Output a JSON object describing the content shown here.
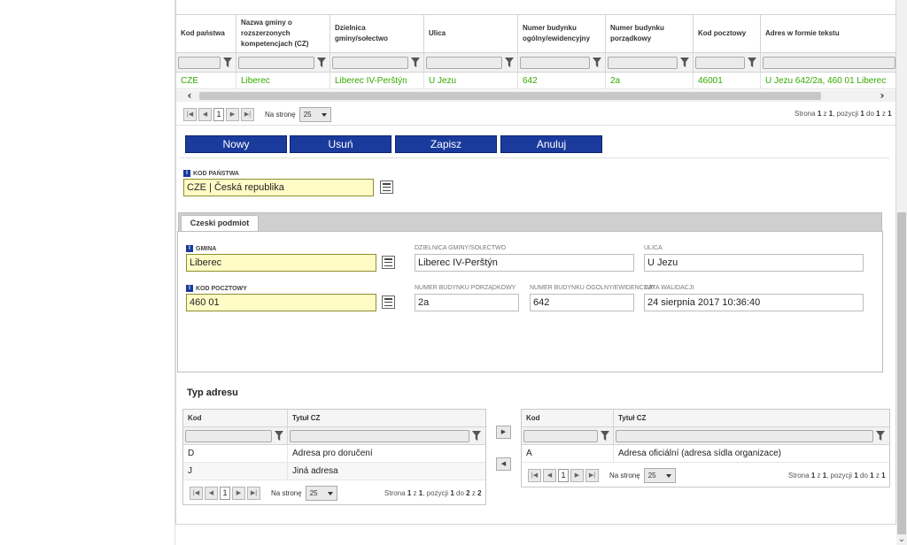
{
  "grid": {
    "columns": [
      "Kod państwa",
      "Nazwa gminy o rozszerzonych kompetencjach (CZ)",
      "Dzielnica gminy/sołectwo",
      "Ulica",
      "Numer budynku ogólny/ewidencyjny",
      "Numer budynku porządkowy",
      "Kod pocztowy",
      "Adres w formie tekstu"
    ],
    "rows": [
      [
        "CZE",
        "Liberec",
        "Liberec IV-Perštýn",
        "U Jezu",
        "642",
        "2a",
        "46001",
        "U Jezu 642/2a, 460 01 Liberec"
      ]
    ],
    "row_color": "#33aa00"
  },
  "pager_top": {
    "page": "1",
    "per_page_label": "Na stronę",
    "per_page": "25",
    "info_prefix": "Strona",
    "info_page": "1",
    "info_z": "z",
    "info_pages": "1",
    "info_mid": ", pozycji",
    "info_from": "1",
    "info_do": "do",
    "info_to": "1",
    "info_z2": "z",
    "info_total": "1"
  },
  "actions": {
    "new": "Nowy",
    "delete": "Usuń",
    "save": "Zapisz",
    "cancel": "Anuluj",
    "color": "#1a3a9c"
  },
  "form": {
    "country_label": "Kod państwa",
    "country_value": "CZE | Česká republika",
    "tab_label": "Czeski podmiot",
    "gmina_label": "Gmina",
    "gmina_value": "Liberec",
    "district_label": "Dzielnica gminy/sołectwo",
    "district_value": "Liberec IV-Perštýn",
    "street_label": "Ulica",
    "street_value": "U Jezu",
    "postal_label": "Kod pocztowy",
    "postal_value": "460 01",
    "house_ord_label": "Numer budynku porządkowy",
    "house_ord_value": "2a",
    "house_gen_label": "Numer budynku ogólny/ewidencyjny",
    "house_gen_value": "642",
    "validation_label": "Data walidacji",
    "validation_value": "24 sierpnia 2017 10:36:40"
  },
  "address_type": {
    "title": "Typ adresu",
    "left": {
      "col_kod": "Kod",
      "col_title": "Tytuł CZ",
      "rows": [
        {
          "kod": "D",
          "title": "Adresa pro doručení"
        },
        {
          "kod": "J",
          "title": "Jiná adresa"
        }
      ],
      "pager": {
        "page": "1",
        "per_page_label": "Na stronę",
        "per_page": "25",
        "info_prefix": "Strona",
        "info_page": "1",
        "info_z": "z",
        "info_pages": "1",
        "info_mid": ", pozycji",
        "info_from": "1",
        "info_do": "do",
        "info_to": "2",
        "info_z2": "z",
        "info_total": "2"
      }
    },
    "right": {
      "col_kod": "Kod",
      "col_title": "Tytuł CZ",
      "rows": [
        {
          "kod": "A",
          "title": "Adresa oficiální (adresa sídla organizace)"
        }
      ],
      "pager": {
        "page": "1",
        "per_page_label": "Na stronę",
        "per_page": "25",
        "info_prefix": "Strona",
        "info_page": "1",
        "info_z": "z",
        "info_pages": "1",
        "info_mid": ", pozycji",
        "info_from": "1",
        "info_do": "do",
        "info_to": "1",
        "info_z2": "z",
        "info_total": "1"
      }
    }
  },
  "icons": [
    "filter-icon",
    "list-picker-icon",
    "info-icon",
    "first-page-icon",
    "prev-page-icon",
    "next-page-icon",
    "last-page-icon",
    "move-right-icon",
    "move-left-icon"
  ]
}
